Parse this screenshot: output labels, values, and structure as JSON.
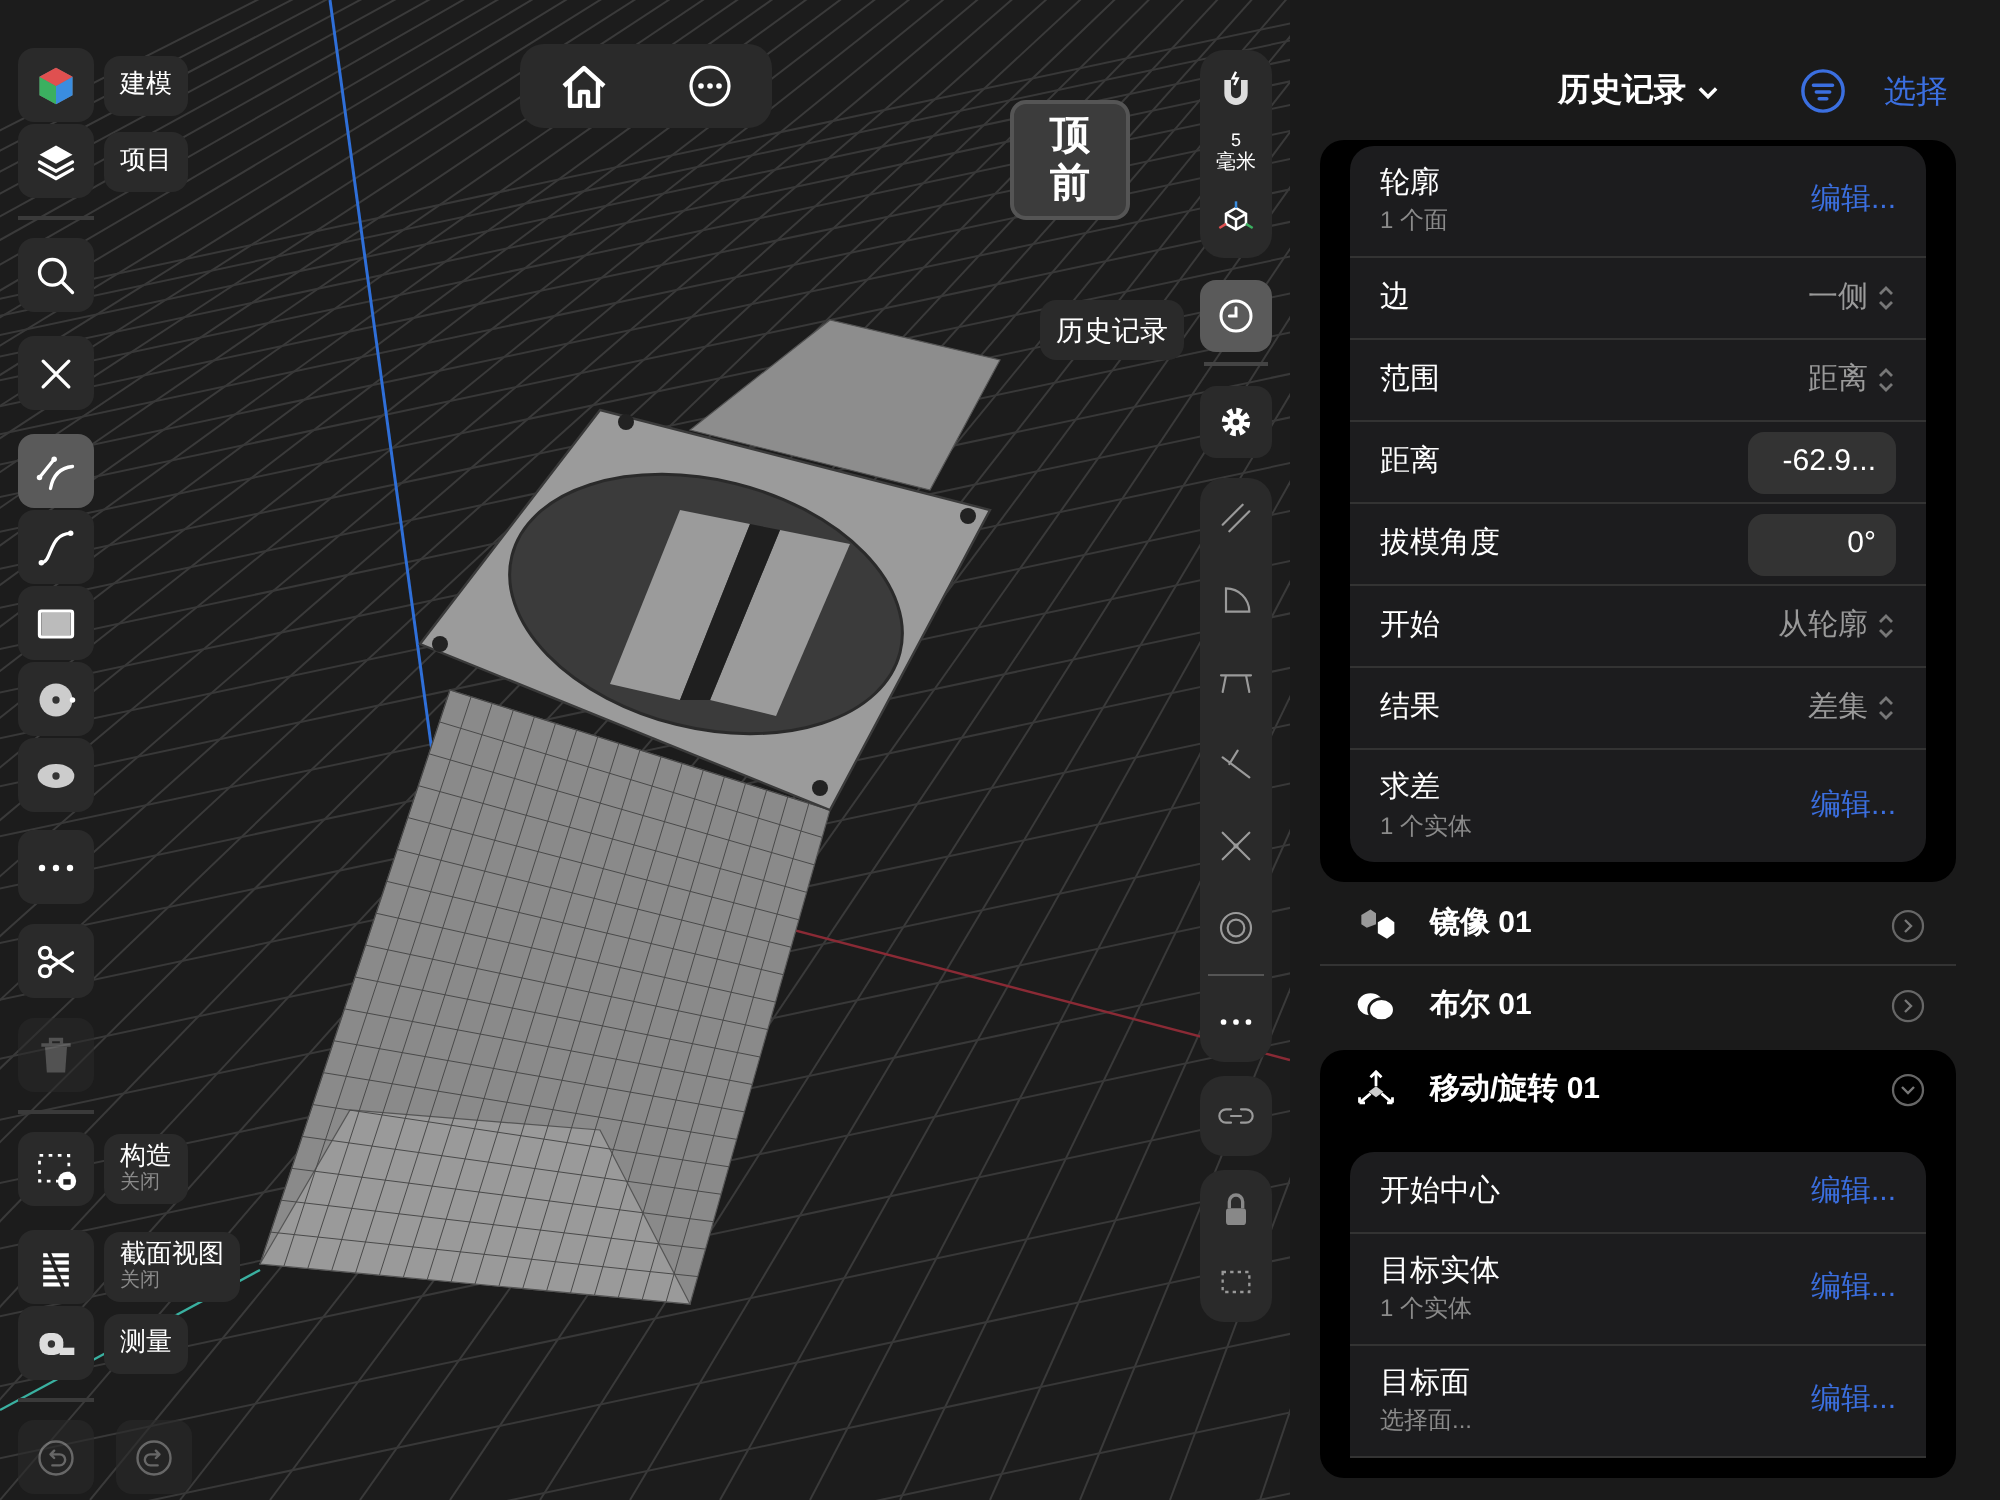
{
  "left_toolbar": {
    "groups": [
      {
        "tools": [
          {
            "label": "建模",
            "selected": false,
            "disabled": false
          },
          {
            "label": "项目",
            "selected": false,
            "disabled": false
          }
        ]
      },
      {
        "tools": [
          {
            "selected": false,
            "disabled": false
          }
        ]
      },
      {
        "tools": [
          {
            "selected": false,
            "disabled": false
          }
        ]
      },
      {
        "tools": [
          {
            "selected": true,
            "disabled": false
          },
          {
            "selected": false,
            "disabled": false
          },
          {
            "selected": false,
            "disabled": false
          },
          {
            "selected": false,
            "disabled": false
          },
          {
            "selected": false,
            "disabled": false
          }
        ]
      },
      {
        "tools": [
          {
            "selected": false,
            "disabled": false
          }
        ]
      },
      {
        "tools": [
          {
            "selected": false,
            "disabled": false
          }
        ]
      },
      {
        "tools": [
          {
            "selected": false,
            "disabled": true
          }
        ]
      },
      {
        "tools": [
          {
            "label": "构造",
            "status": "关闭",
            "selected": false,
            "disabled": false
          },
          {
            "label": "截面视图",
            "status": "关闭",
            "selected": false,
            "disabled": false
          },
          {
            "label": "测量",
            "selected": false,
            "disabled": false
          }
        ]
      }
    ],
    "history_buttons": [
      {
        "disabled": true
      },
      {
        "disabled": true
      }
    ]
  },
  "view_cube": {
    "top": "顶",
    "front": "前"
  },
  "history_tooltip": "历史记录",
  "right_toolbar": {
    "snap_value": "5",
    "snap_unit": "毫米",
    "history_selected": true
  },
  "panel": {
    "title": "历史记录",
    "select_label": "选择",
    "features": [
      {
        "expanded": true,
        "params": [
          {
            "kind": "edit",
            "label": "轮廓",
            "detail": "1 个面",
            "action": "编辑..."
          },
          {
            "kind": "picker",
            "label": "边",
            "value": "一侧"
          },
          {
            "kind": "picker",
            "label": "范围",
            "value": "距离"
          },
          {
            "kind": "field",
            "label": "距离",
            "value": "-62.9..."
          },
          {
            "kind": "field",
            "label": "拔模角度",
            "value": "0°"
          },
          {
            "kind": "picker",
            "label": "开始",
            "value": "从轮廓"
          },
          {
            "kind": "picker",
            "label": "结果",
            "value": "差集"
          },
          {
            "kind": "edit",
            "label": "求差",
            "detail": "1 个实体",
            "action": "编辑..."
          }
        ]
      },
      {
        "name": "镜像 01",
        "expanded": false
      },
      {
        "name": "布尔 01",
        "expanded": false
      },
      {
        "name": "移动/旋转 01",
        "expanded": true,
        "params": [
          {
            "kind": "edit",
            "label": "开始中心",
            "action": "编辑..."
          },
          {
            "kind": "edit",
            "label": "目标实体",
            "detail": "1 个实体",
            "action": "编辑..."
          },
          {
            "kind": "edit",
            "label": "目标面",
            "detail": "选择面...",
            "action": "编辑..."
          }
        ]
      }
    ]
  }
}
